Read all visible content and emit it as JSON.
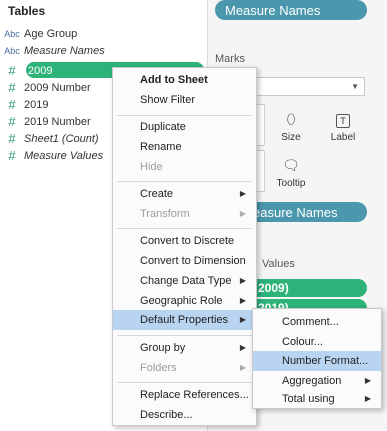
{
  "data_pane": {
    "title": "Tables",
    "fields": [
      {
        "type_icon": "Abc",
        "label": "Age Group",
        "italic": false
      },
      {
        "type_icon": "Abc",
        "label": "Measure Names",
        "italic": true
      },
      {
        "type_icon": "#",
        "label": "2009",
        "italic": false,
        "selected": true
      },
      {
        "type_icon": "#",
        "label": "2009 Number",
        "italic": false
      },
      {
        "type_icon": "#",
        "label": "2019",
        "italic": false
      },
      {
        "type_icon": "#",
        "label": "2019 Number",
        "italic": false
      },
      {
        "type_icon": "#",
        "label": "Sheet1 (Count)",
        "italic": true
      },
      {
        "type_icon": "#",
        "label": "Measure Values",
        "italic": true
      }
    ]
  },
  "shelves": {
    "columns_pill": "Measure Names",
    "marks_title": "Marks",
    "marks_type": "omatic",
    "mark_buttons": {
      "size": "Size",
      "label": "Label",
      "tooltip": "Tooltip"
    },
    "mark_label_icon": "T",
    "marks_pill": "easure Names",
    "values_title": "Values",
    "value_pills": [
      "2009)",
      "2019)"
    ]
  },
  "context_menu": {
    "items": [
      {
        "label": "Add to Sheet",
        "bold": true
      },
      {
        "label": "Show Filter"
      },
      {
        "label": "Duplicate"
      },
      {
        "label": "Rename"
      },
      {
        "label": "Hide",
        "disabled": true
      },
      {
        "label": "Create",
        "submenu": true
      },
      {
        "label": "Transform",
        "submenu": true,
        "disabled": true
      },
      {
        "label": "Convert to Discrete"
      },
      {
        "label": "Convert to Dimension"
      },
      {
        "label": "Change Data Type",
        "submenu": true
      },
      {
        "label": "Geographic Role",
        "submenu": true
      },
      {
        "label": "Default Properties",
        "submenu": true,
        "highlighted": true
      },
      {
        "label": "Group by",
        "submenu": true
      },
      {
        "label": "Folders",
        "submenu": true,
        "disabled": true
      },
      {
        "label": "Replace References..."
      },
      {
        "label": "Describe..."
      }
    ]
  },
  "submenu": {
    "items": [
      {
        "label": "Comment..."
      },
      {
        "label": "Colour..."
      },
      {
        "label": "Number Format...",
        "highlighted": true
      },
      {
        "label": "Aggregation",
        "submenu": true
      },
      {
        "label": "Total using",
        "submenu": true
      }
    ]
  },
  "colors": {
    "measure_green": "#2db37a",
    "dimension_blue": "#4b97ad",
    "menu_highlight": "#b8d4f0"
  }
}
